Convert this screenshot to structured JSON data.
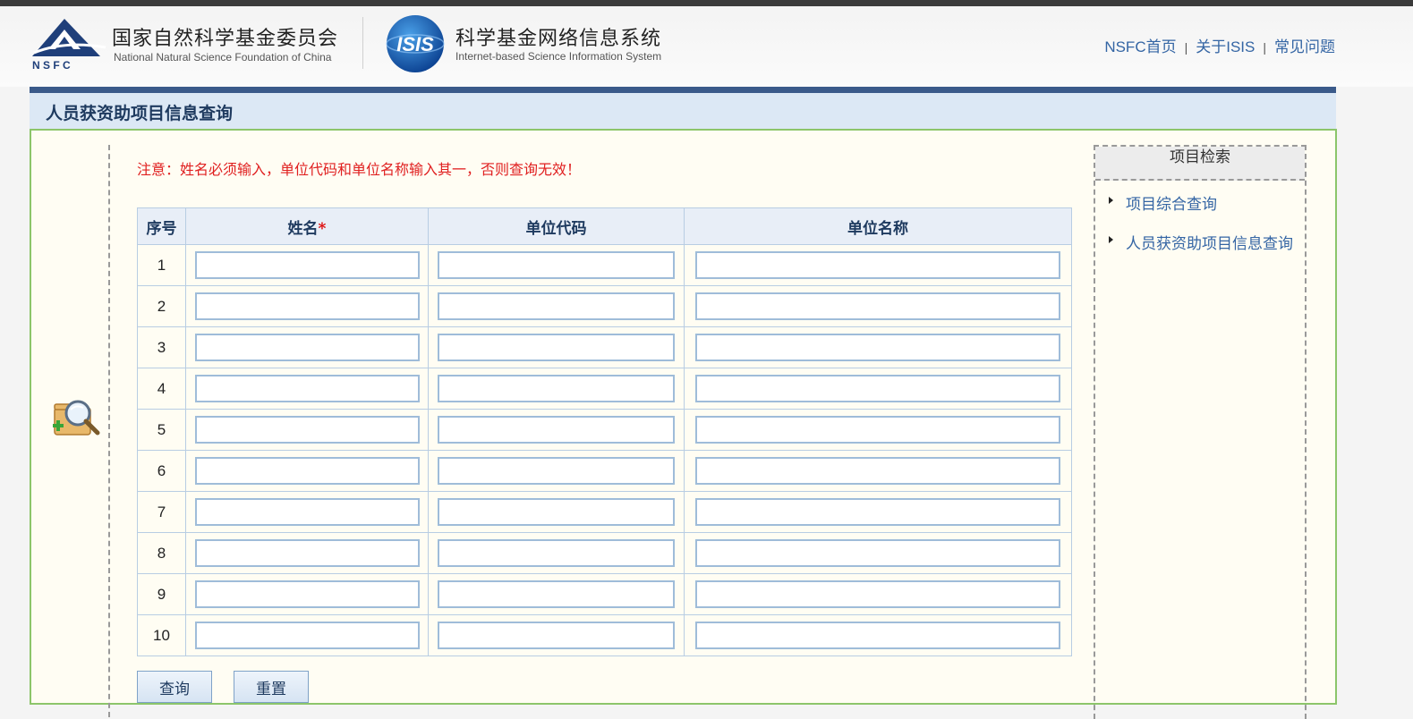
{
  "header": {
    "org_name_cn": "国家自然科学基金委员会",
    "org_name_en": "National Natural Science Foundation of China",
    "logo_abbr": "N S F C",
    "isis_logo_text": "ISIS",
    "system_name_cn": "科学基金网络信息系统",
    "system_name_en": "Internet-based Science Information System",
    "nav": [
      "NSFC首页",
      "关于ISIS",
      "常见问题"
    ],
    "nav_separator": "|"
  },
  "page": {
    "title": "人员获资助项目信息查询",
    "notice": "注意：姓名必须输入，单位代码和单位名称输入其一，否则查询无效！"
  },
  "table": {
    "headers": {
      "index": "序号",
      "name": "姓名",
      "required_mark": "*",
      "org_code": "单位代码",
      "org_name": "单位名称"
    },
    "rows": [
      {
        "index": "1",
        "name": "",
        "org_code": "",
        "org_name": ""
      },
      {
        "index": "2",
        "name": "",
        "org_code": "",
        "org_name": ""
      },
      {
        "index": "3",
        "name": "",
        "org_code": "",
        "org_name": ""
      },
      {
        "index": "4",
        "name": "",
        "org_code": "",
        "org_name": ""
      },
      {
        "index": "5",
        "name": "",
        "org_code": "",
        "org_name": ""
      },
      {
        "index": "6",
        "name": "",
        "org_code": "",
        "org_name": ""
      },
      {
        "index": "7",
        "name": "",
        "org_code": "",
        "org_name": ""
      },
      {
        "index": "8",
        "name": "",
        "org_code": "",
        "org_name": ""
      },
      {
        "index": "9",
        "name": "",
        "org_code": "",
        "org_name": ""
      },
      {
        "index": "10",
        "name": "",
        "org_code": "",
        "org_name": ""
      }
    ]
  },
  "buttons": {
    "query": "查询",
    "reset": "重置"
  },
  "sidebar": {
    "title": "项目检索",
    "items": [
      {
        "label": "项目综合查询"
      },
      {
        "label": "人员获资助项目信息查询"
      }
    ]
  },
  "icons": {
    "decorative_search": "search-document-icon",
    "nsfc_logo": "nsfc-logo",
    "isis_logo": "isis-globe-logo",
    "sidebar_bullet": "triangle-right-icon"
  },
  "colors": {
    "brand_blue": "#3a5a8a",
    "link_blue": "#3465a4",
    "notice_red": "#e02020",
    "panel_border_green": "#8cc56a",
    "title_bar_bg": "#dce8f5"
  }
}
